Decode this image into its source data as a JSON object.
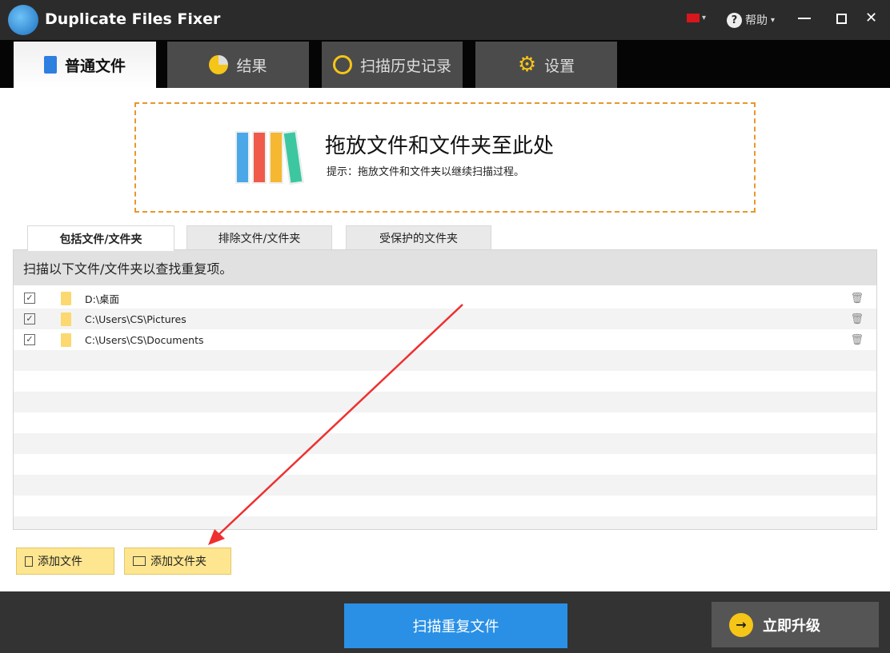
{
  "app": {
    "title": "Duplicate Files Fixer",
    "help_label": "帮助"
  },
  "tabs": [
    {
      "label": "普通文件"
    },
    {
      "label": "结果"
    },
    {
      "label": "扫描历史记录"
    },
    {
      "label": "设置"
    }
  ],
  "dropzone": {
    "title": "拖放文件和文件夹至此处",
    "hint": "提示：拖放文件和文件夹以继续扫描过程。"
  },
  "subtabs": [
    {
      "label": "包括文件/文件夹"
    },
    {
      "label": "排除文件/文件夹"
    },
    {
      "label": "受保护的文件夹"
    }
  ],
  "panel": {
    "header": "扫描以下文件/文件夹以查找重复项。",
    "items": [
      {
        "path": "D:\\桌面",
        "checked": true
      },
      {
        "path": "C:\\Users\\CS\\Pictures",
        "checked": true
      },
      {
        "path": "C:\\Users\\CS\\Documents",
        "checked": true
      }
    ]
  },
  "buttons": {
    "add_file": "添加文件",
    "add_folder": "添加文件夹",
    "scan": "扫描重复文件",
    "upgrade": "立即升级"
  },
  "colors": {
    "accent": "#2a90e6",
    "dash": "#e8962e",
    "yellow": "#fde68f"
  }
}
